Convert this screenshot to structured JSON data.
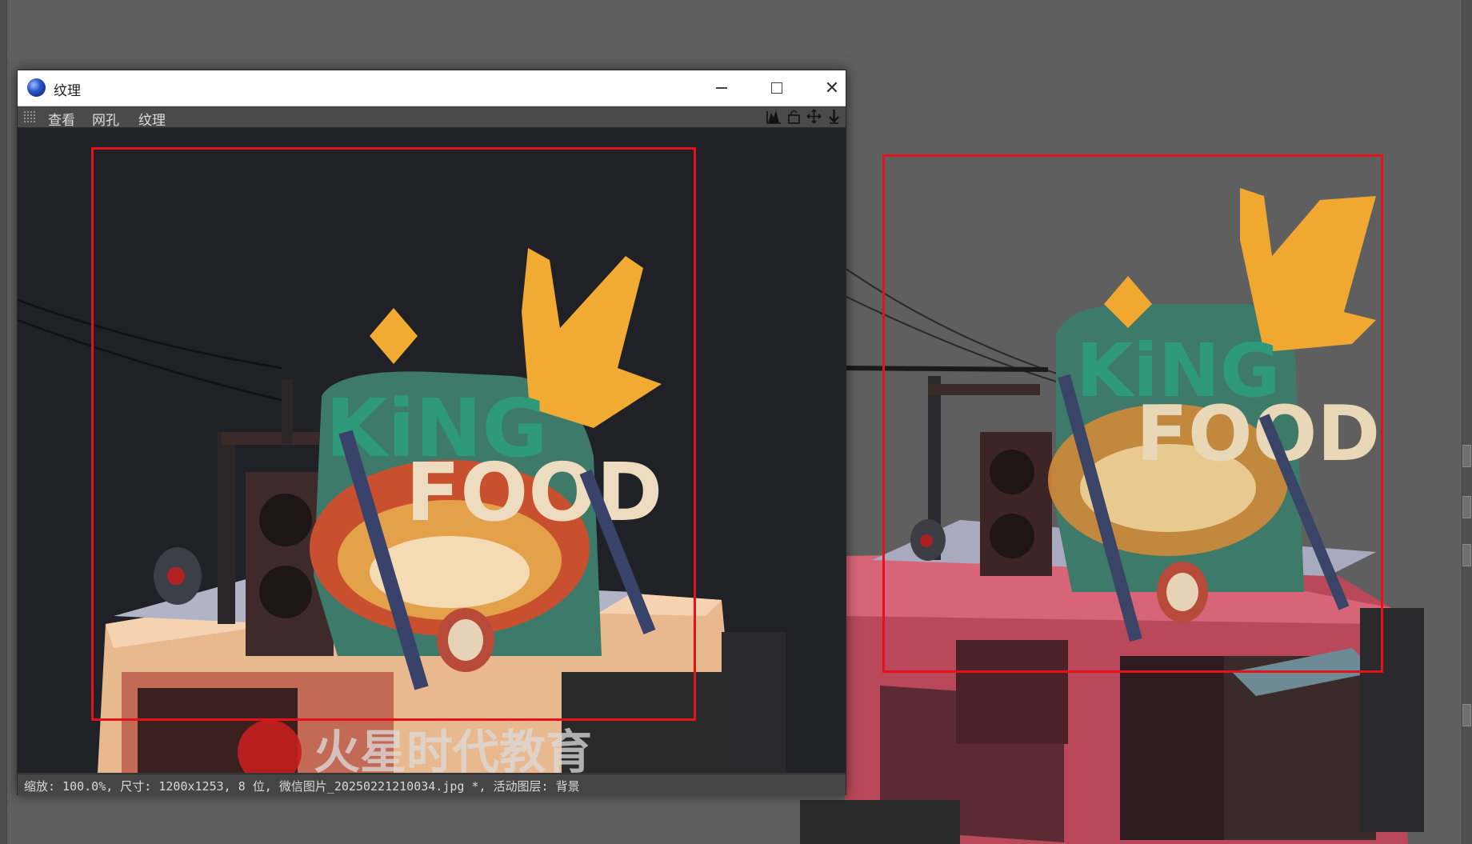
{
  "window": {
    "title": "纹理",
    "controls": {
      "minimize": "—",
      "maximize": "☐",
      "close": "✕"
    }
  },
  "menu": {
    "items": [
      "查看",
      "网孔",
      "纹理"
    ]
  },
  "toolbar_icons": [
    "histogram-icon",
    "lock-icon",
    "move-icon",
    "download-arrow-icon"
  ],
  "texture": {
    "sign_line1": "KiNG",
    "sign_line2": "FOOD",
    "watermark": "火星时代教育"
  },
  "viewport_model": {
    "sign_line1": "KiNG",
    "sign_line2": "FOOD"
  },
  "status": {
    "text": "缩放: 100.0%, 尺寸: 1200x1253, 8 位, 微信图片_20250221210034.jpg *, 活动图层: 背景"
  },
  "colors": {
    "selection": "#e4121b",
    "viewport_bg": "#5f5f5f",
    "texture_bg": "#1e2025",
    "truck_pink": "#b8485a",
    "sign_green": "#3d7a6a",
    "crown_gold": "#f0a830"
  }
}
